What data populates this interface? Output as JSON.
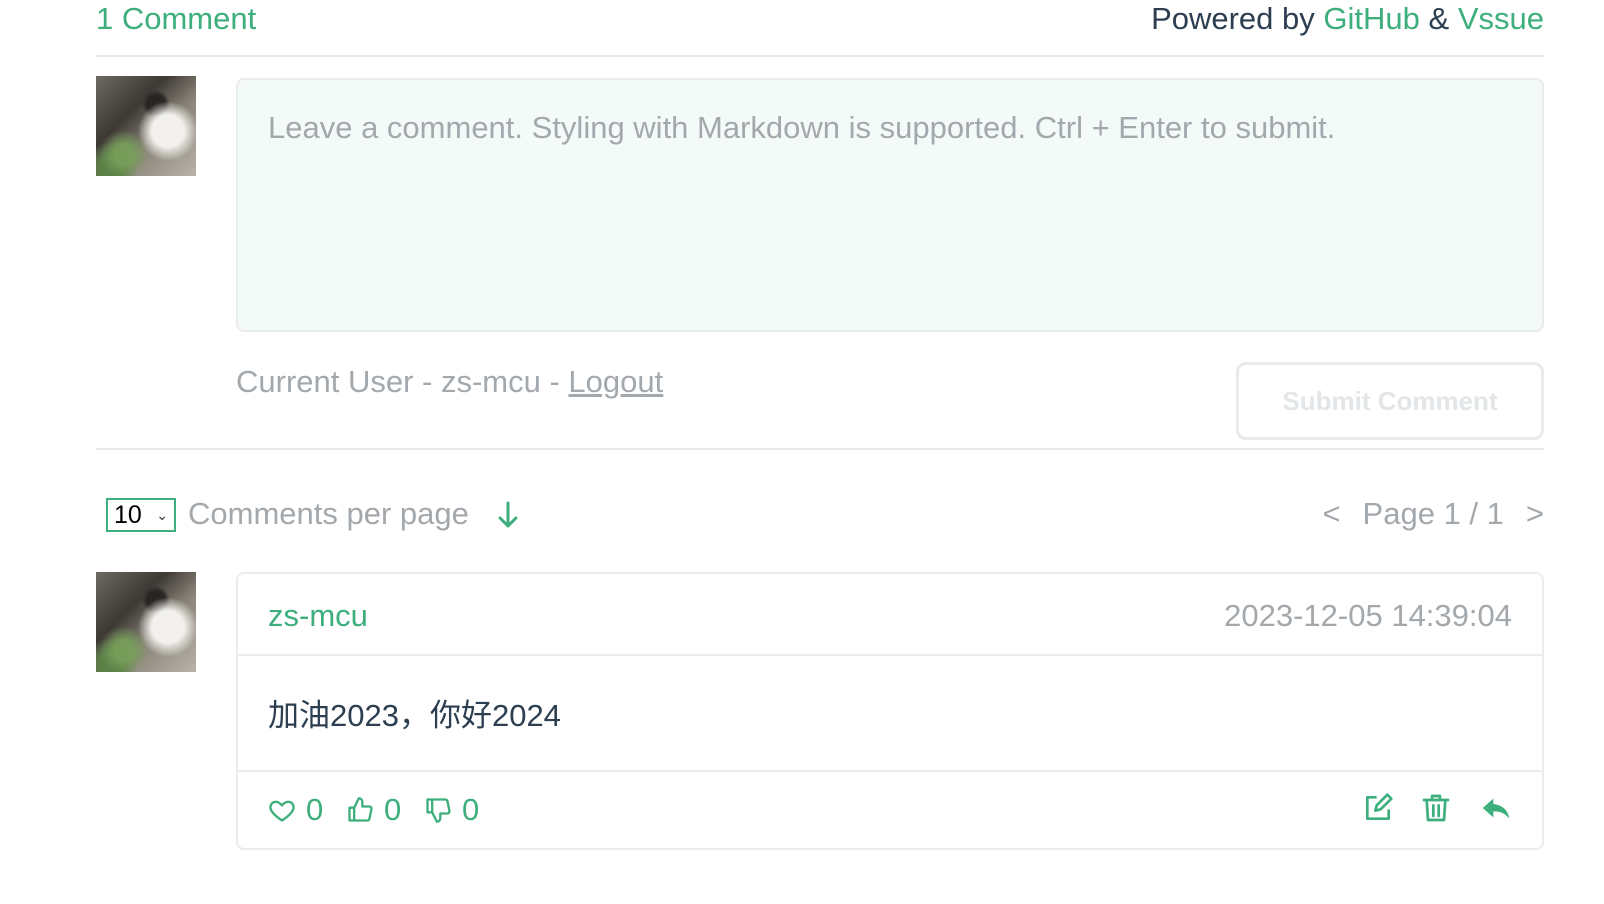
{
  "header": {
    "comment_count": "1 Comment",
    "powered_prefix": "Powered by",
    "github": "GitHub",
    "amp": "&",
    "vssue": "Vssue"
  },
  "editor": {
    "placeholder": "Leave a comment. Styling with Markdown is supported. Ctrl + Enter to submit."
  },
  "user": {
    "prefix": "Current User - zs-mcu - ",
    "logout": "Logout"
  },
  "submit_label": "Submit Comment",
  "pagination": {
    "per_page_value": "10",
    "per_page_label": "Comments per page",
    "prev": "<",
    "page_text": "Page 1 / 1",
    "next": ">"
  },
  "comment": {
    "author": "zs-mcu",
    "time": "2023-12-05 14:39:04",
    "body": "加油2023，你好2024",
    "hearts": "0",
    "thumbs_up": "0",
    "thumbs_down": "0"
  },
  "colors": {
    "accent": "#3eaf7c",
    "muted": "#a3a8ad",
    "text": "#2c3e50",
    "border": "#eaecee",
    "editor_bg": "#f4faf8"
  },
  "icons": [
    "sort-down-arrow-icon",
    "heart-icon",
    "thumbs-up-icon",
    "thumbs-down-icon",
    "edit-icon",
    "trash-icon",
    "reply-icon"
  ]
}
